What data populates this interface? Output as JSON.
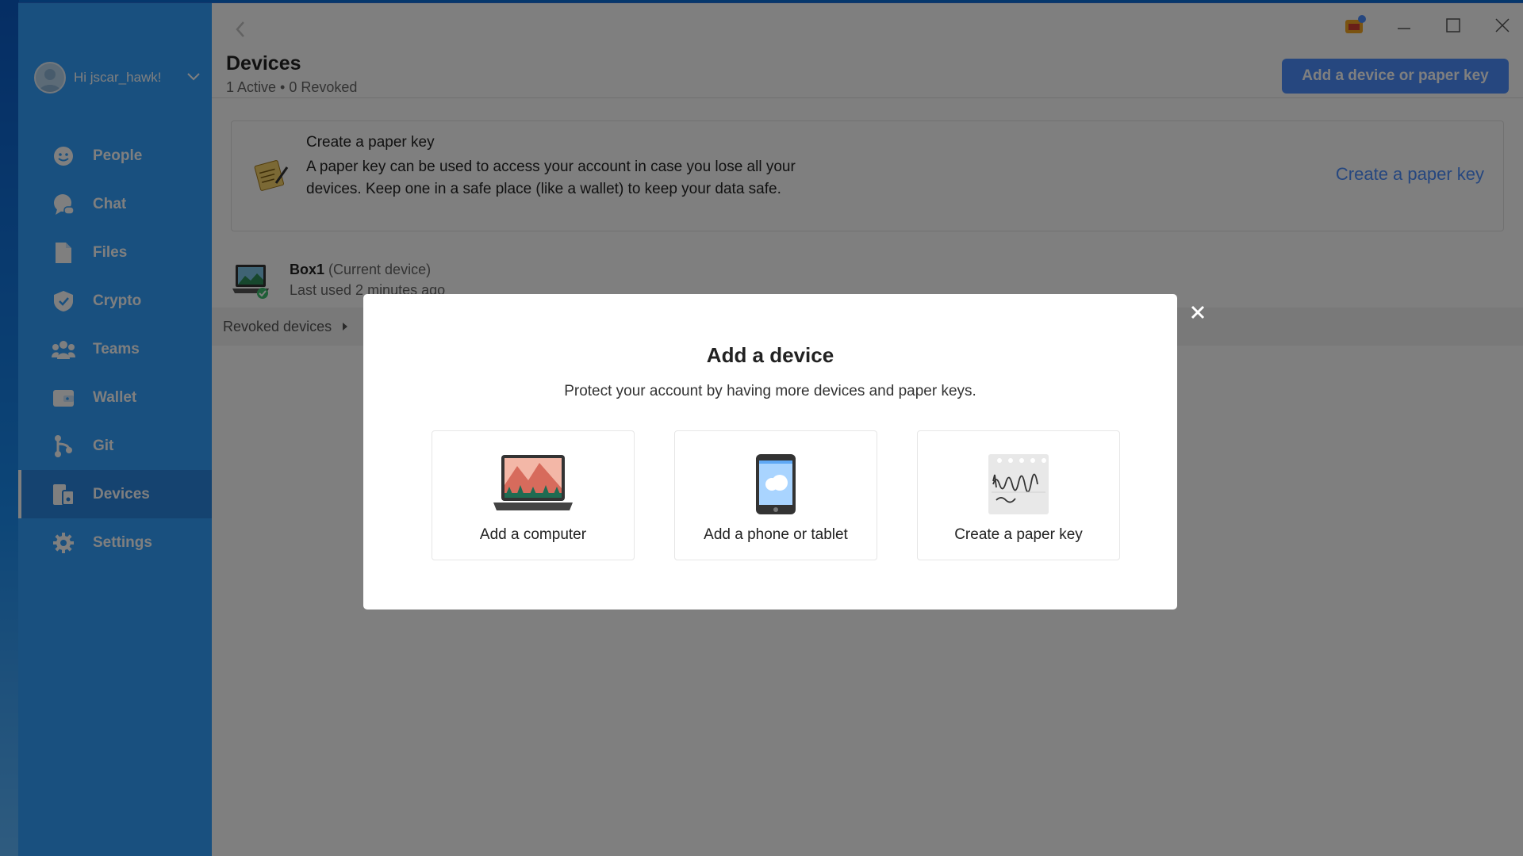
{
  "sidebar": {
    "user_label": "Hi jscar_hawk!",
    "items": [
      {
        "label": "People",
        "icon": "people-icon"
      },
      {
        "label": "Chat",
        "icon": "chat-icon"
      },
      {
        "label": "Files",
        "icon": "files-icon"
      },
      {
        "label": "Crypto",
        "icon": "crypto-icon"
      },
      {
        "label": "Teams",
        "icon": "teams-icon"
      },
      {
        "label": "Wallet",
        "icon": "wallet-icon"
      },
      {
        "label": "Git",
        "icon": "git-icon"
      },
      {
        "label": "Devices",
        "icon": "devices-icon",
        "active": true
      },
      {
        "label": "Settings",
        "icon": "settings-icon"
      }
    ]
  },
  "header": {
    "title": "Devices",
    "subtitle": "1 Active • 0 Revoked",
    "add_button": "Add a device or paper key"
  },
  "paper_key_card": {
    "title": "Create a paper key",
    "description": "A paper key can be used to access your account in case you lose all your devices. Keep one in a safe place (like a wallet) to keep your data safe.",
    "link": "Create a paper key"
  },
  "device": {
    "name": "Box1",
    "current": "(Current device)",
    "last_used": "Last used 2 minutes ago"
  },
  "revoked": {
    "label": "Revoked devices"
  },
  "modal": {
    "title": "Add a device",
    "subtitle": "Protect your account by having more devices and paper keys.",
    "options": [
      {
        "label": "Add a computer",
        "icon": "computer-icon"
      },
      {
        "label": "Add a phone or tablet",
        "icon": "phone-icon"
      },
      {
        "label": "Create a paper key",
        "icon": "paper-key-icon"
      }
    ]
  },
  "colors": {
    "sidebar": "#33a0ff",
    "accent": "#4c8eff",
    "overlay": "rgba(0,0,0,0.5)"
  }
}
